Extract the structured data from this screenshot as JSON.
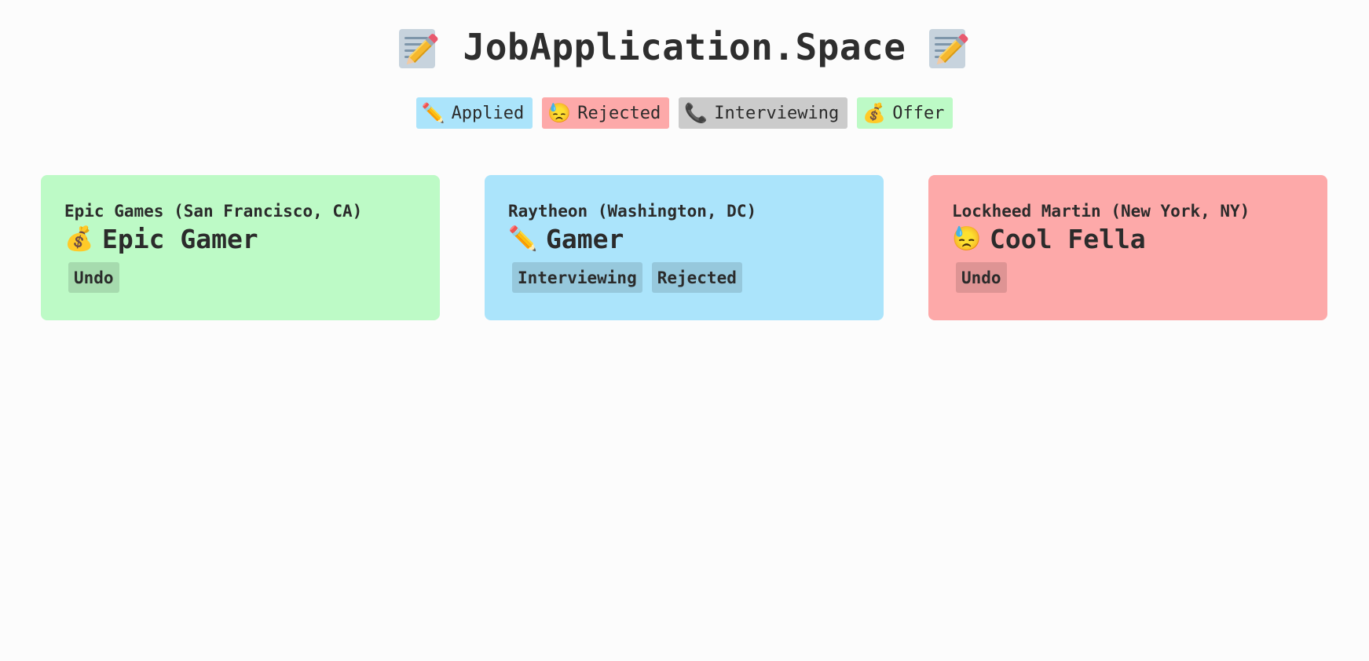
{
  "header": {
    "title": "JobApplication.Space",
    "left_icon": "memo-icon",
    "right_icon": "memo-icon"
  },
  "legend": [
    {
      "emoji": "✏️",
      "icon": "pencil-icon",
      "label": "Applied",
      "color": "#abe4fb"
    },
    {
      "emoji": "😓",
      "icon": "sweat-face-icon",
      "label": "Rejected",
      "color": "#fda9a9"
    },
    {
      "emoji": "📞",
      "icon": "phone-icon",
      "label": "Interviewing",
      "color": "#cbcbcb"
    },
    {
      "emoji": "💰",
      "icon": "money-bag-icon",
      "label": "Offer",
      "color": "#bdfac6"
    }
  ],
  "applications": [
    {
      "company": "Epic Games",
      "location": "(San Francisco, CA)",
      "status_emoji": "💰",
      "status_icon": "money-bag-icon",
      "role": "Epic Gamer",
      "status": "Offer",
      "actions": [
        "Undo"
      ]
    },
    {
      "company": "Raytheon",
      "location": "(Washington, DC)",
      "status_emoji": "✏️",
      "status_icon": "pencil-icon",
      "role": "Gamer",
      "status": "Applied",
      "actions": [
        "Interviewing",
        "Rejected"
      ]
    },
    {
      "company": "Lockheed Martin",
      "location": "(New York, NY)",
      "status_emoji": "😓",
      "status_icon": "sweat-face-icon",
      "role": "Cool Fella",
      "status": "Rejected",
      "actions": [
        "Undo"
      ]
    }
  ]
}
